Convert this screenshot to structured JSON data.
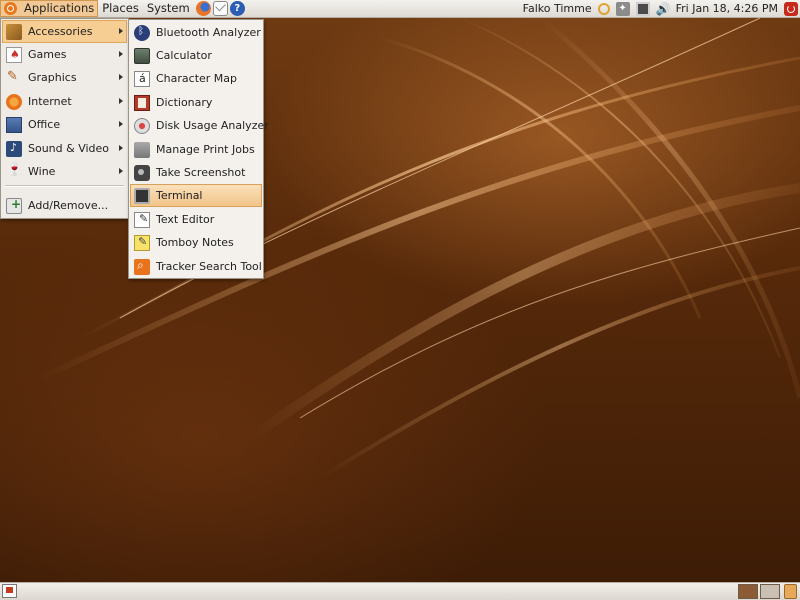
{
  "top_panel": {
    "menus": {
      "applications": "Applications",
      "places": "Places",
      "system": "System"
    },
    "launchers": [
      "firefox-icon",
      "mail-icon",
      "help-icon"
    ],
    "user_name": "Falko Timme",
    "clock": "Fri Jan 18,  4:26 PM",
    "tray_icons": [
      "keyring-icon",
      "updates-icon",
      "network-icon",
      "volume-icon",
      "power-icon"
    ]
  },
  "applications_menu": {
    "items": [
      {
        "label": "Accessories",
        "icon": "accessories-icon",
        "submenu": true,
        "active": true
      },
      {
        "label": "Games",
        "icon": "games-icon",
        "submenu": true
      },
      {
        "label": "Graphics",
        "icon": "graphics-icon",
        "submenu": true
      },
      {
        "label": "Internet",
        "icon": "internet-icon",
        "submenu": true
      },
      {
        "label": "Office",
        "icon": "office-icon",
        "submenu": true
      },
      {
        "label": "Sound & Video",
        "icon": "sound-video-icon",
        "submenu": true
      },
      {
        "label": "Wine",
        "icon": "wine-icon",
        "submenu": true
      },
      {
        "label": "Add/Remove...",
        "icon": "add-remove-icon",
        "submenu": false
      }
    ]
  },
  "accessories_submenu": {
    "items": [
      {
        "label": "Bluetooth Analyzer",
        "icon": "bluetooth-icon"
      },
      {
        "label": "Calculator",
        "icon": "calculator-icon"
      },
      {
        "label": "Character Map",
        "icon": "character-map-icon"
      },
      {
        "label": "Dictionary",
        "icon": "dictionary-icon"
      },
      {
        "label": "Disk Usage Analyzer",
        "icon": "disk-usage-icon"
      },
      {
        "label": "Manage Print Jobs",
        "icon": "printer-icon"
      },
      {
        "label": "Take Screenshot",
        "icon": "camera-icon"
      },
      {
        "label": "Terminal",
        "icon": "terminal-icon",
        "highlighted": true
      },
      {
        "label": "Text Editor",
        "icon": "text-editor-icon"
      },
      {
        "label": "Tomboy Notes",
        "icon": "tomboy-icon"
      },
      {
        "label": "Tracker Search Tool",
        "icon": "tracker-search-icon"
      }
    ]
  },
  "bottom_panel": {
    "items": [
      "show-desktop-icon",
      "workspace-1",
      "workspace-2",
      "trash-icon"
    ],
    "active_workspace": 1
  },
  "colors": {
    "accent": "#f2c995",
    "menu_background": "#efebe7",
    "desktop": "#56290a"
  }
}
